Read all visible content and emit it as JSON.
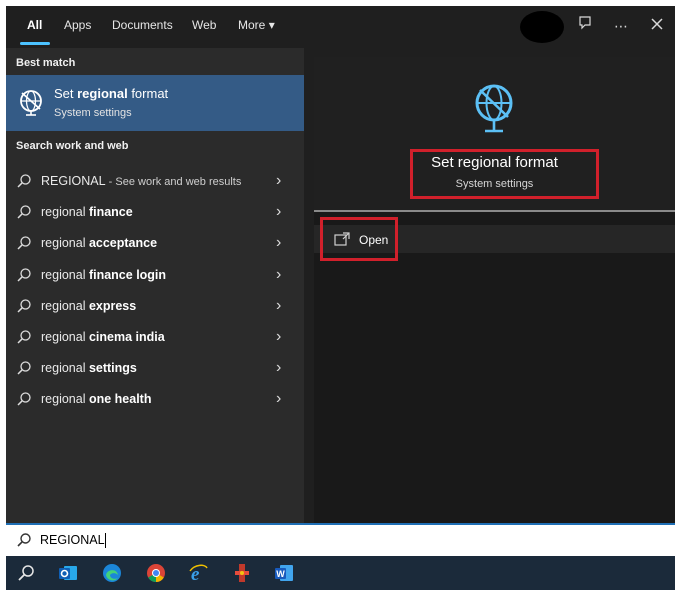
{
  "tabs": [
    {
      "label": "All"
    },
    {
      "label": "Apps"
    },
    {
      "label": "Documents"
    },
    {
      "label": "Web"
    },
    {
      "label": "More"
    }
  ],
  "top_icons": [
    "avatar",
    "feedback-icon",
    "more-options-icon",
    "close-icon"
  ],
  "left": {
    "best_match_title": "Best match",
    "best_match": {
      "title_prefix": "Set ",
      "title_bold": "regional",
      "title_suffix": " format",
      "subtitle": "System settings"
    },
    "search_title": "Search work and web",
    "results": [
      {
        "prefix": "REGIONAL",
        "bold": "",
        "extra": " - See work and web results"
      },
      {
        "prefix": "regional ",
        "bold": "finance",
        "extra": ""
      },
      {
        "prefix": "regional ",
        "bold": "acceptance",
        "extra": ""
      },
      {
        "prefix": "regional ",
        "bold": "finance login",
        "extra": ""
      },
      {
        "prefix": "regional ",
        "bold": "express",
        "extra": ""
      },
      {
        "prefix": "regional ",
        "bold": "cinema india",
        "extra": ""
      },
      {
        "prefix": "regional ",
        "bold": "settings",
        "extra": ""
      },
      {
        "prefix": "regional ",
        "bold": "one health",
        "extra": ""
      }
    ]
  },
  "right": {
    "title": "Set regional format",
    "subtitle": "System settings",
    "open_label": "Open"
  },
  "search": {
    "value": "REGIONAL"
  },
  "taskbar": [
    "search-icon",
    "outlook-icon",
    "edge-icon",
    "chrome-icon",
    "ie-icon",
    "app-icon",
    "word-icon"
  ],
  "colors": {
    "accent": "#4cc2ff",
    "selected": "#345b86",
    "highlight_box": "#d1202b"
  }
}
